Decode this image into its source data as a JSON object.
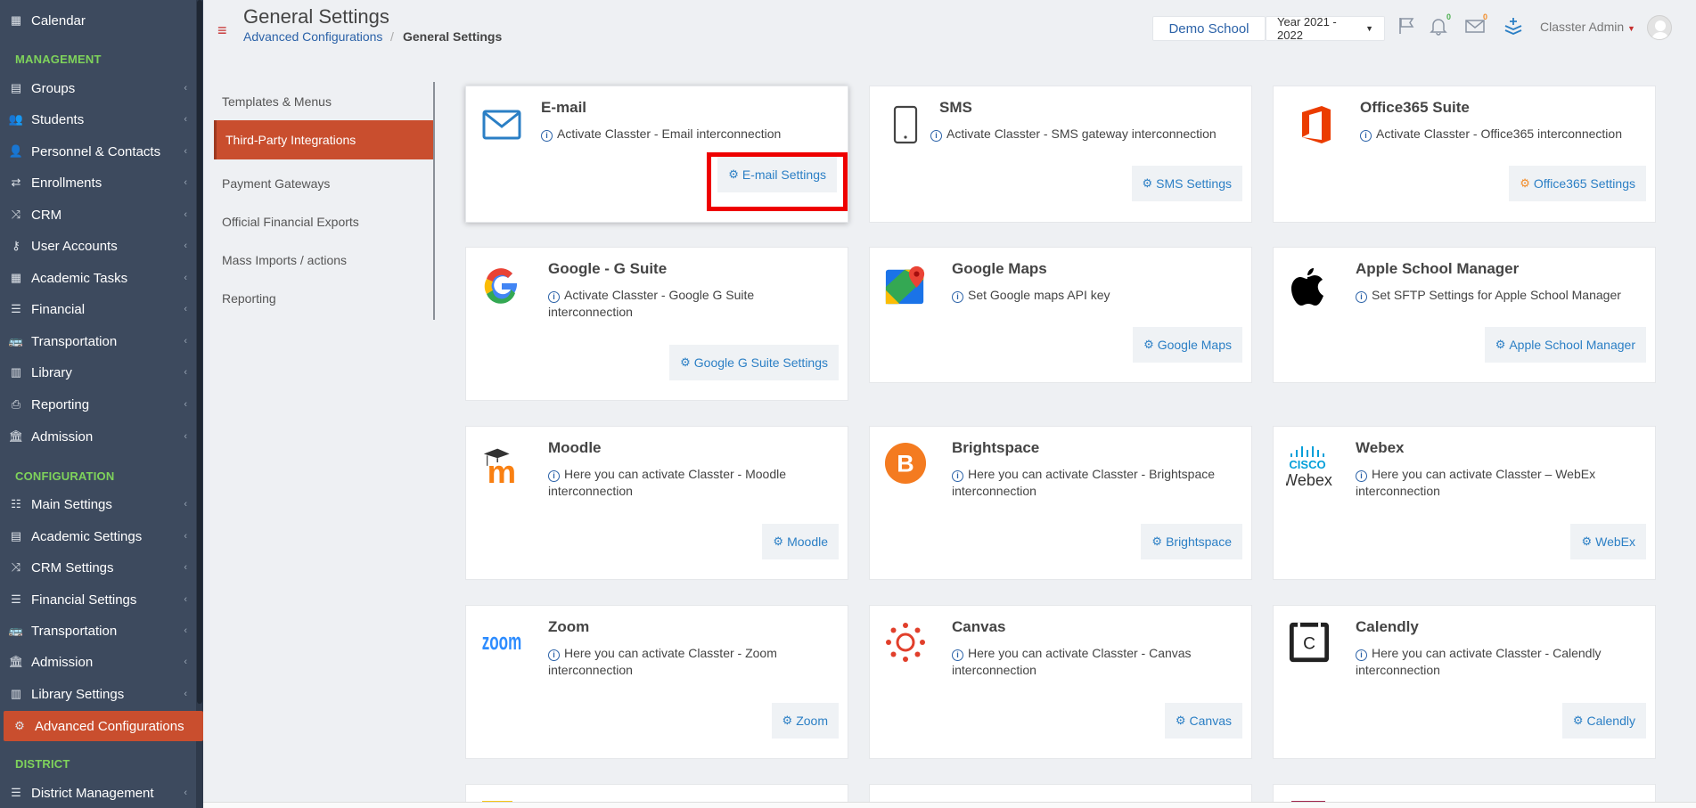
{
  "sidebar": {
    "items": [
      {
        "label": "Calendar",
        "icon": "calendar-icon",
        "glyph": "▦"
      },
      {
        "label": "Groups",
        "icon": "groups-icon",
        "glyph": "▤"
      },
      {
        "label": "Students",
        "icon": "students-icon",
        "glyph": "👥"
      },
      {
        "label": "Personnel & Contacts",
        "icon": "personnel-icon",
        "glyph": "👤"
      },
      {
        "label": "Enrollments",
        "icon": "enrollments-icon",
        "glyph": "⇄"
      },
      {
        "label": "CRM",
        "icon": "crm-icon",
        "glyph": "⤨"
      },
      {
        "label": "User Accounts",
        "icon": "key-icon",
        "glyph": "⚷"
      },
      {
        "label": "Academic Tasks",
        "icon": "academic-tasks-icon",
        "glyph": "▦"
      },
      {
        "label": "Financial",
        "icon": "financial-icon",
        "glyph": "☰"
      },
      {
        "label": "Transportation",
        "icon": "bus-icon",
        "glyph": "🚌"
      },
      {
        "label": "Library",
        "icon": "library-icon",
        "glyph": "▥"
      },
      {
        "label": "Reporting",
        "icon": "print-icon",
        "glyph": "⎙"
      },
      {
        "label": "Admission",
        "icon": "admission-icon",
        "glyph": "🏛"
      },
      {
        "label": "Main Settings",
        "icon": "sliders-icon",
        "glyph": "☷"
      },
      {
        "label": "Academic Settings",
        "icon": "academic-settings-icon",
        "glyph": "▤"
      },
      {
        "label": "CRM Settings",
        "icon": "crm-settings-icon",
        "glyph": "⤨"
      },
      {
        "label": "Financial Settings",
        "icon": "financial-settings-icon",
        "glyph": "☰"
      },
      {
        "label": "Transportation",
        "icon": "bus-icon",
        "glyph": "🚌"
      },
      {
        "label": "Admission",
        "icon": "admission-icon",
        "glyph": "🏛"
      },
      {
        "label": "Library Settings",
        "icon": "library-icon",
        "glyph": "▥"
      },
      {
        "label": "Advanced Configurations",
        "icon": "gears-icon",
        "glyph": "⚙"
      },
      {
        "label": "District Management",
        "icon": "list-icon",
        "glyph": "☰"
      }
    ],
    "sections": {
      "management": "MANAGEMENT",
      "configuration": "CONFIGURATION",
      "district": "DISTRICT"
    }
  },
  "header": {
    "title": "General Settings",
    "breadcrumb_link": "Advanced Configurations",
    "breadcrumb_sep": "/",
    "breadcrumb_current": "General Settings",
    "school": "Demo School",
    "year": "Year 2021 - 2022",
    "notifications_count": "0",
    "messages_count": "0",
    "user": "Classter Admin"
  },
  "subnav": {
    "items": [
      "Templates & Menus",
      "Third-Party Integrations",
      "Payment Gateways",
      "Official Financial Exports",
      "Mass Imports / actions",
      "Reporting"
    ]
  },
  "cards": [
    {
      "title": "E-mail",
      "desc": "Activate Classter - Email interconnection",
      "button": "E-mail Settings",
      "icon": "envelope-icon"
    },
    {
      "title": "SMS",
      "desc": "Activate Classter - SMS gateway interconnection",
      "button": "SMS Settings",
      "icon": "mobile-phone-icon"
    },
    {
      "title": "Office365 Suite",
      "desc": "Activate Classter - Office365 interconnection",
      "button": "Office365 Settings",
      "icon": "office365-logo-icon"
    },
    {
      "title": "Google - G Suite",
      "desc": "Activate Classter - Google G Suite interconnection",
      "button": "Google G Suite Settings",
      "icon": "google-logo-icon"
    },
    {
      "title": "Google Maps",
      "desc": "Set Google maps API key",
      "button": "Google Maps",
      "icon": "google-maps-logo-icon"
    },
    {
      "title": "Apple School Manager",
      "desc": "Set SFTP Settings for Apple School Manager",
      "button": "Apple School Manager",
      "icon": "apple-logo-icon"
    },
    {
      "title": "Moodle",
      "desc": "Here you can activate Classter - Moodle interconnection",
      "button": "Moodle",
      "icon": "moodle-logo-icon"
    },
    {
      "title": "Brightspace",
      "desc": "Here you can activate Classter - Brightspace interconnection",
      "button": "Brightspace",
      "icon": "brightspace-logo-icon"
    },
    {
      "title": "Webex",
      "desc": "Here you can activate Classter – WebEx interconnection",
      "button": "WebEx",
      "icon": "cisco-webex-logo-icon"
    },
    {
      "title": "Zoom",
      "desc": "Here you can activate Classter - Zoom interconnection",
      "button": "Zoom",
      "icon": "zoom-logo-icon"
    },
    {
      "title": "Canvas",
      "desc": "Here you can activate Classter - Canvas interconnection",
      "button": "Canvas",
      "icon": "canvas-logo-icon"
    },
    {
      "title": "Calendly",
      "desc": "Here you can activate Classter - Calendly interconnection",
      "button": "Calendly",
      "icon": "calendly-logo-icon"
    }
  ],
  "logo_text": {
    "cisco": "CISCO",
    "webex": "Webex",
    "zoom": "zoom",
    "moodle": "m",
    "brightspace": "B",
    "calendly": "C",
    "google": "G"
  },
  "colors": {
    "sidebar_bg": "#3d4a5e",
    "active_accent": "#c94e2e",
    "section_label": "#7fd35b",
    "link_blue": "#2b62a8",
    "button_text": "#2b7fc5",
    "highlight_box": "#ee0000"
  }
}
